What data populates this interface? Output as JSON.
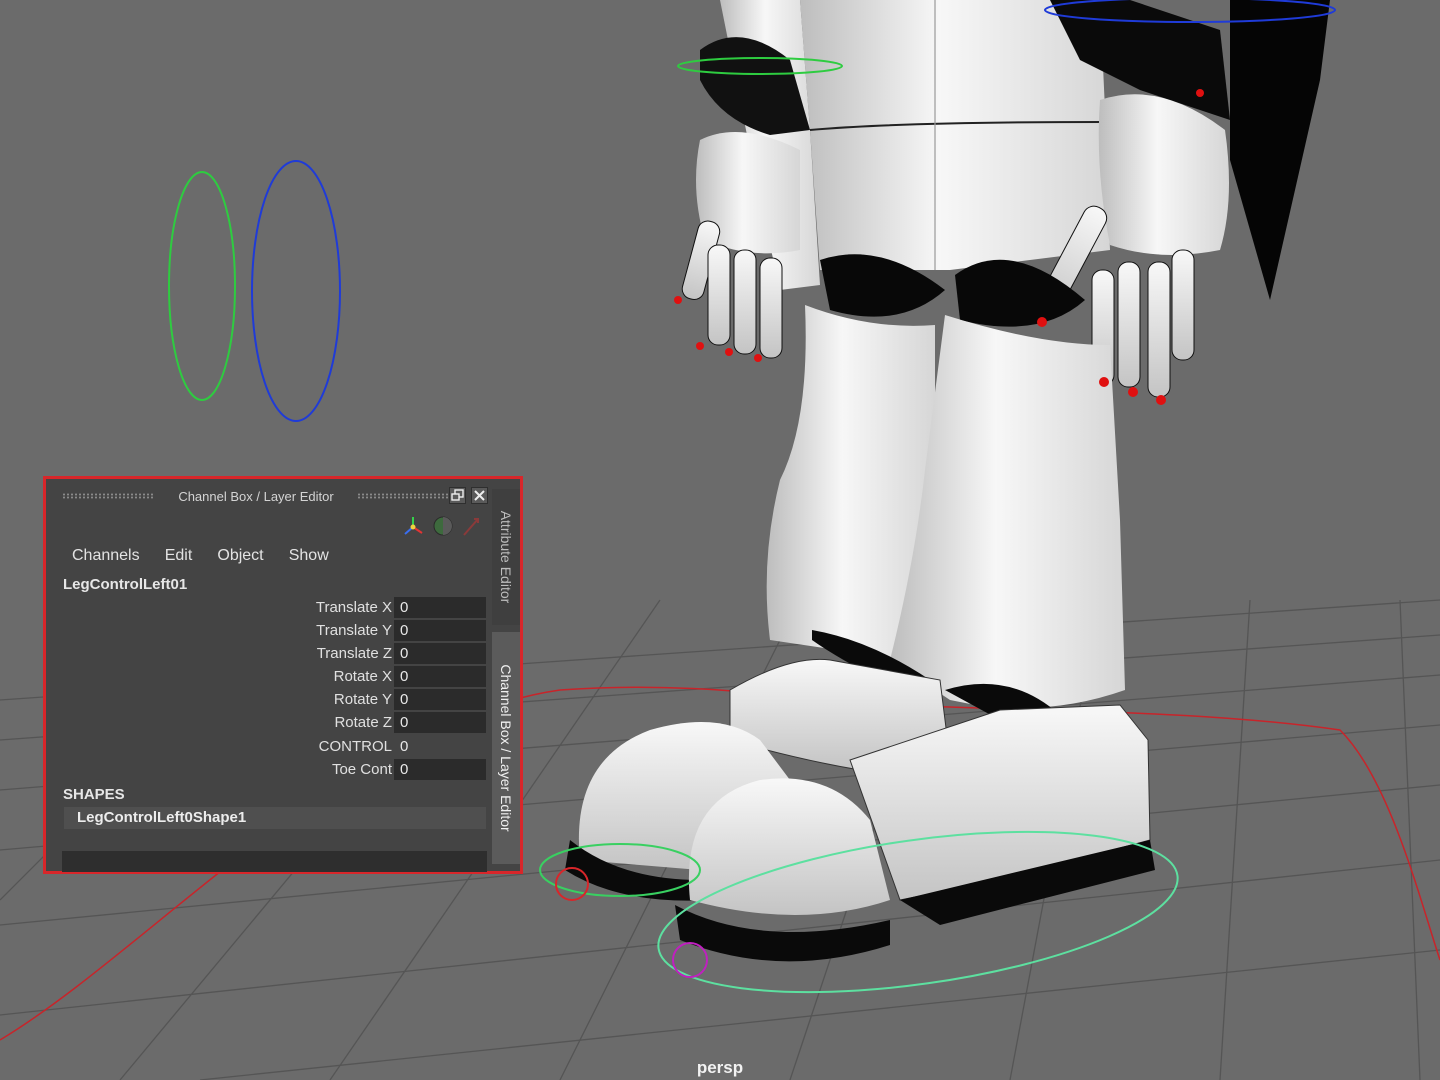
{
  "viewport": {
    "camera_label": "persp"
  },
  "channel_box": {
    "title": "Channel Box / Layer Editor",
    "menu": [
      "Channels",
      "Edit",
      "Object",
      "Show"
    ],
    "node_name": "LegControlLeft01",
    "attributes": [
      {
        "label": "Translate X",
        "value": "0"
      },
      {
        "label": "Translate Y",
        "value": "0"
      },
      {
        "label": "Translate Z",
        "value": "0"
      },
      {
        "label": "Rotate X",
        "value": "0"
      },
      {
        "label": "Rotate Y",
        "value": "0"
      },
      {
        "label": "Rotate Z",
        "value": "0"
      },
      {
        "label": "CONTROL",
        "value": "0"
      },
      {
        "label": "Toe Cont",
        "value": "0"
      }
    ],
    "shapes_heading": "SHAPES",
    "shape_name": "LegControlLeft0Shape1",
    "side_tabs": {
      "attribute_editor": "Attribute Editor",
      "channel_box": "Channel Box / Layer Editor"
    },
    "border_color": "#d8262a"
  }
}
